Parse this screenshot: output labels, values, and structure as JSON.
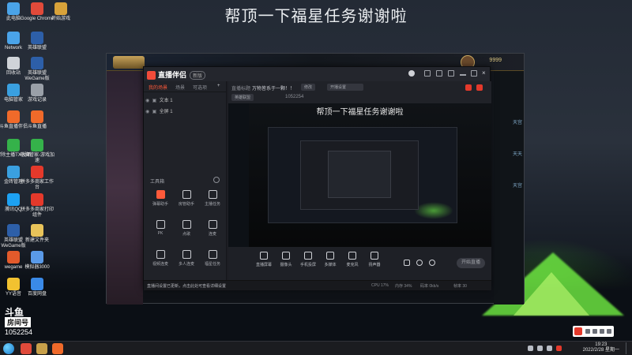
{
  "headline": "帮顶一下福星任务谢谢啦",
  "desktop_icons": [
    {
      "label": "此电脑",
      "color": "#4aa3e8"
    },
    {
      "label": "Google Chrome",
      "color": "#e04a3a"
    },
    {
      "label": "开始游戏",
      "color": "#d8a23a"
    },
    {
      "label": "Network",
      "color": "#4aa3e8"
    },
    {
      "label": "英雄联盟",
      "color": "#2d5fa8"
    },
    {
      "label": "回收站",
      "color": "#cfd3d8"
    },
    {
      "label": "英雄联盟WeGame版",
      "color": "#2d5fa8"
    },
    {
      "label": "电脑管家",
      "color": "#3aa0e0"
    },
    {
      "label": "游戏记录",
      "color": "#9aa0a8"
    },
    {
      "label": "斗鱼直播伴侣",
      "color": "#f06a2a"
    },
    {
      "label": "斗鱼直播",
      "color": "#f06a2a"
    },
    {
      "label": "解除主播TX大师",
      "color": "#35b24a"
    },
    {
      "label": "电脑管家-游戏加速",
      "color": "#35b24a"
    },
    {
      "label": "金砖管理",
      "color": "#3aa0e0"
    },
    {
      "label": "拼多多商家工作台",
      "color": "#e4392b"
    },
    {
      "label": "腾讯QQ",
      "color": "#1da1f2"
    },
    {
      "label": "拼多多商家打印组件",
      "color": "#e4392b"
    },
    {
      "label": "英雄联盟WeGame版",
      "color": "#2d5fa8"
    },
    {
      "label": "新建文件夹",
      "color": "#e8c35a"
    },
    {
      "label": "wegame",
      "color": "#e25a2b"
    },
    {
      "label": "模拟器3000",
      "color": "#5a9ae8"
    },
    {
      "label": "YY语音",
      "color": "#f2c230"
    },
    {
      "label": "百度网盘",
      "color": "#3a8ae8"
    }
  ],
  "game": {
    "currency": "9999",
    "side_words": [
      "天宫",
      "天天",
      "天宫"
    ]
  },
  "app": {
    "name": "直播伴侣",
    "version": "新版",
    "tabs": [
      "我的场景",
      "场景",
      "可选项"
    ],
    "scenes": [
      "文本 1",
      "全屏 1"
    ],
    "tools_title": "工具箱",
    "tools": [
      {
        "label": "弹幕助手",
        "hot": true
      },
      {
        "label": "房管助手",
        "hot": false
      },
      {
        "label": "主播任务",
        "hot": false
      },
      {
        "label": "PK",
        "hot": false
      },
      {
        "label": "点歌",
        "hot": false
      },
      {
        "label": "连麦",
        "hot": false
      },
      {
        "label": "视频连麦",
        "hot": false
      },
      {
        "label": "多人连麦",
        "hot": false
      },
      {
        "label": "福星任务",
        "hot": false
      }
    ],
    "title_label": "直播标题",
    "title_text": "万物皆系于一颗！！",
    "category": "英雄联盟",
    "room": "1052254",
    "pills": [
      "修改",
      "开播设置"
    ],
    "preview_title": "帮顶一下福星任务谢谢啦",
    "controls": [
      "直播屏幕",
      "摄像头",
      "手机投屏",
      "多媒体",
      "麦克风",
      "扬声器"
    ],
    "golive": "开始直播",
    "notice": "直播间设置已更新，点击此处可查看详细设置",
    "stats": [
      "CPU 17%",
      "内存 34%",
      "码率 0kb/s",
      "帧率 30"
    ]
  },
  "watermark": {
    "line1": "斗鱼",
    "line2": "房间号",
    "room": "1052254"
  },
  "clock": {
    "time": "19:23",
    "date": "2022/2/28 星期一"
  }
}
